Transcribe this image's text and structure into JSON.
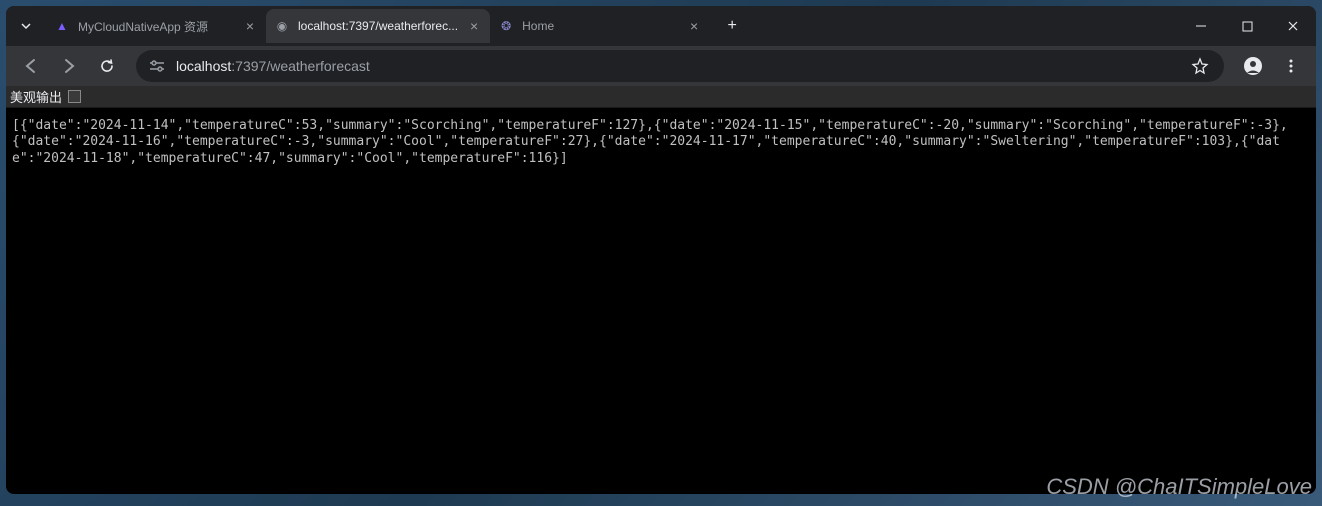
{
  "tabs": [
    {
      "title": "MyCloudNativeApp 资源",
      "favicon_color": "#7b5cff",
      "favicon_glyph": "▲"
    },
    {
      "title": "localhost:7397/weatherforec...",
      "favicon_color": "#9aa0a6",
      "favicon_glyph": "◉"
    },
    {
      "title": "Home",
      "favicon_color": "#5b6ee1",
      "favicon_glyph": "❂"
    }
  ],
  "active_tab_index": 1,
  "address": {
    "host": "localhost",
    "port": ":7397",
    "path": "/weatherforecast"
  },
  "pretty_print": {
    "label": "美观输出",
    "checked": false
  },
  "json_text": "[{\"date\":\"2024-11-14\",\"temperatureC\":53,\"summary\":\"Scorching\",\"temperatureF\":127},{\"date\":\"2024-11-15\",\"temperatureC\":-20,\"summary\":\"Scorching\",\"temperatureF\":-3},{\"date\":\"2024-11-16\",\"temperatureC\":-3,\"summary\":\"Cool\",\"temperatureF\":27},{\"date\":\"2024-11-17\",\"temperatureC\":40,\"summary\":\"Sweltering\",\"temperatureF\":103},{\"date\":\"2024-11-18\",\"temperatureC\":47,\"summary\":\"Cool\",\"temperatureF\":116}]",
  "watermark": "CSDN @ChaITSimpleLove"
}
